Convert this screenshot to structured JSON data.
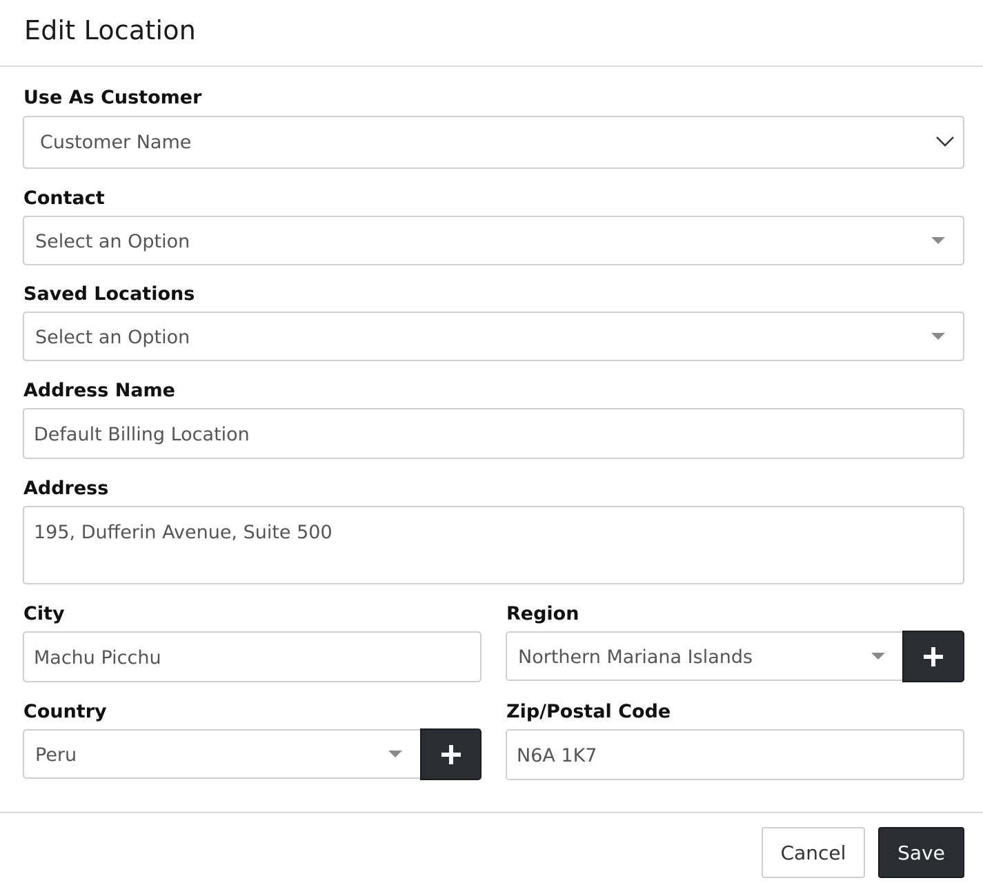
{
  "modal": {
    "title": "Edit Location"
  },
  "form": {
    "use_as_customer": {
      "label": "Use As Customer",
      "value": "Customer Name"
    },
    "contact": {
      "label": "Contact",
      "value": "Select an Option"
    },
    "saved_locations": {
      "label": "Saved Locations",
      "value": "Select an Option"
    },
    "address_name": {
      "label": "Address Name",
      "value": "Default Billing Location"
    },
    "address": {
      "label": "Address",
      "value": "195, Dufferin Avenue, Suite 500"
    },
    "city": {
      "label": "City",
      "value": "Machu Picchu"
    },
    "region": {
      "label": "Region",
      "value": "Northern Mariana Islands"
    },
    "country": {
      "label": "Country",
      "value": "Peru"
    },
    "zip": {
      "label": "Zip/Postal Code",
      "value": "N6A 1K7"
    }
  },
  "footer": {
    "cancel_label": "Cancel",
    "save_label": "Save"
  },
  "icons": {
    "select_chevron": "chevron-down-icon",
    "dropdown_caret": "caret-down-icon",
    "add": "plus-icon"
  },
  "colors": {
    "primary_button": "#2a2d31",
    "border": "#cfcfcf",
    "divider": "#dcdcdc"
  }
}
